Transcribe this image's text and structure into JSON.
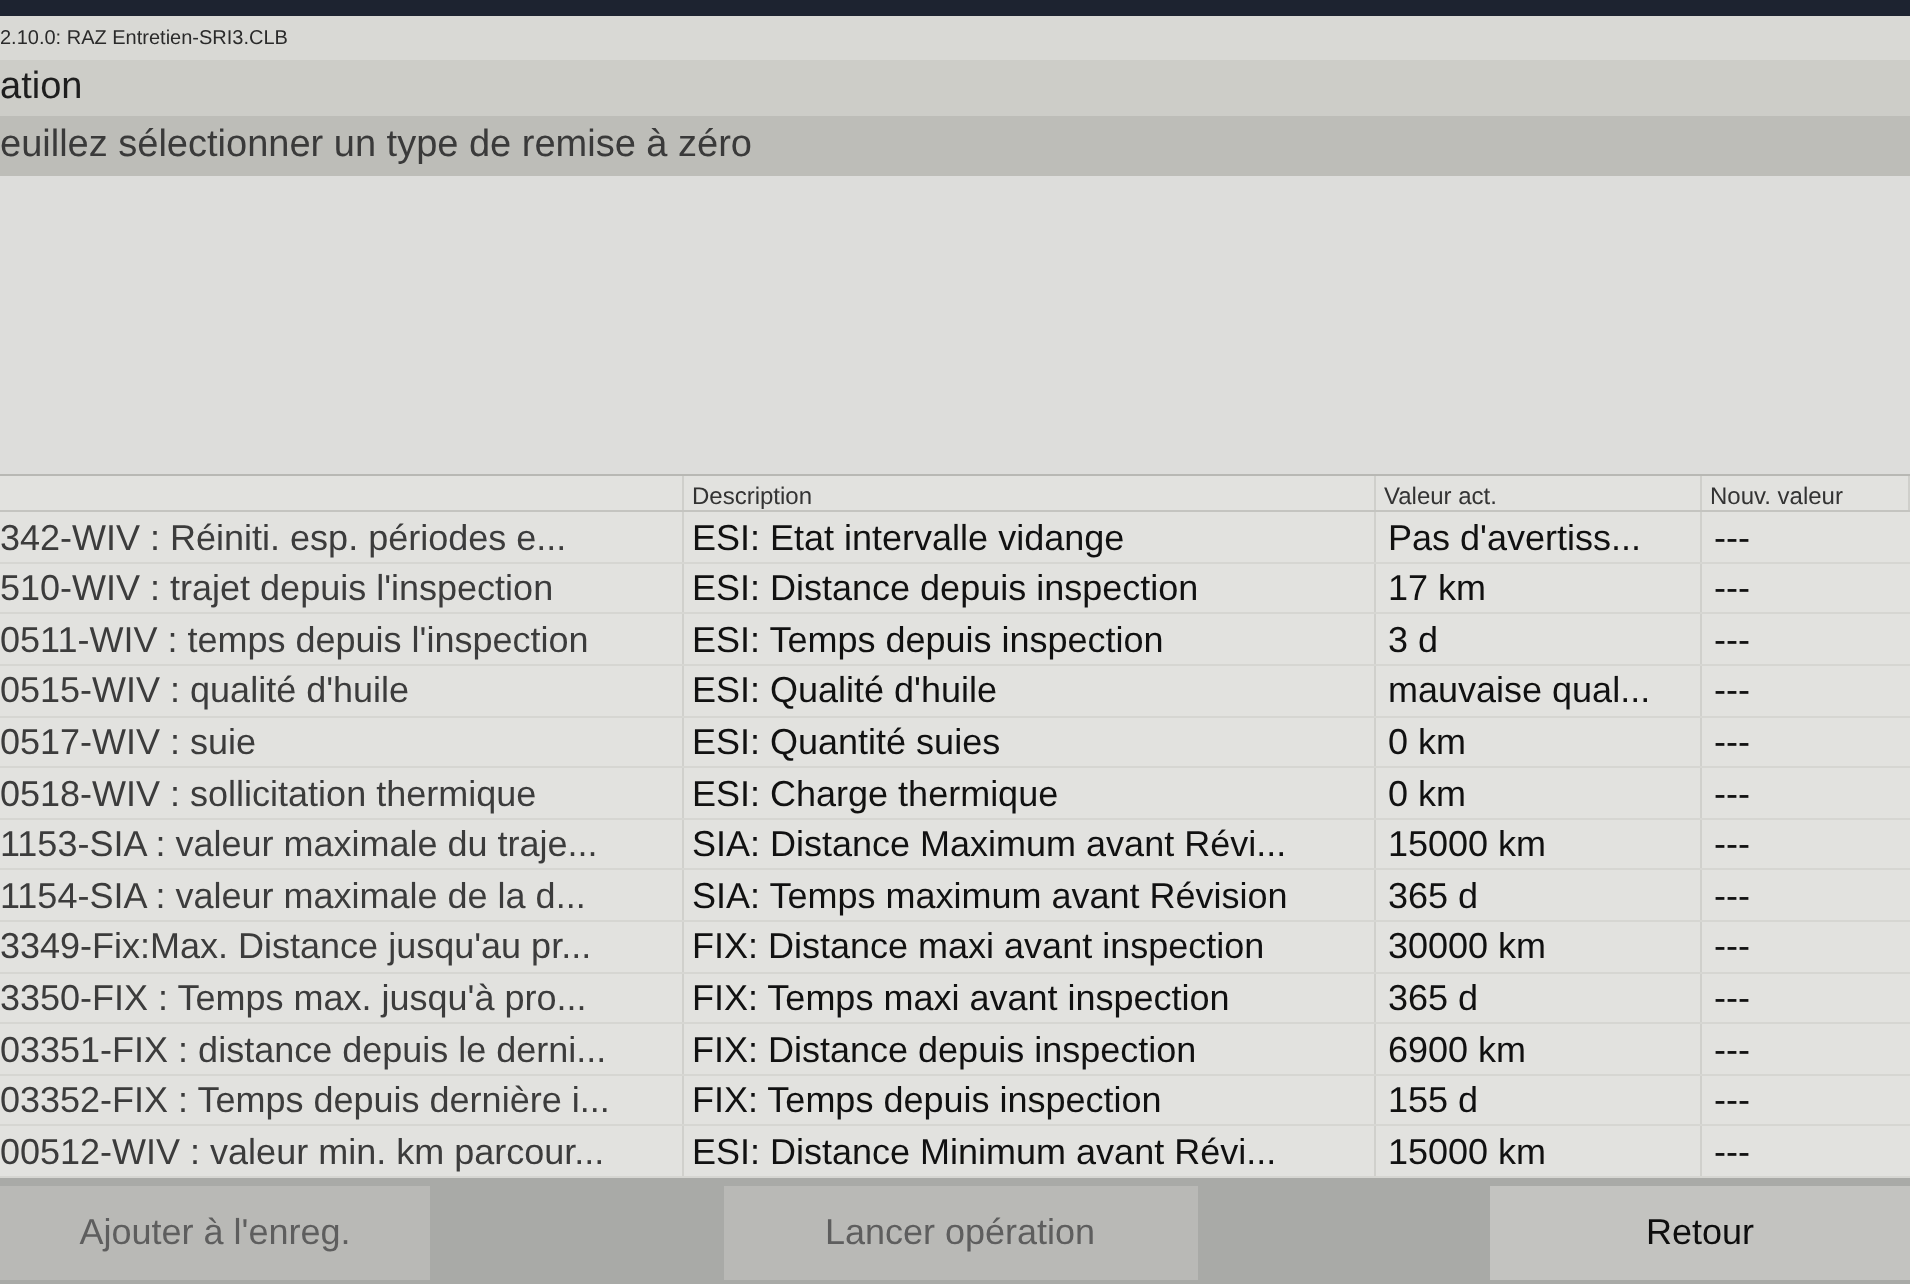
{
  "window": {
    "title": "2.10.0: RAZ Entretien-SRI3.CLB"
  },
  "header": {
    "title": "ation"
  },
  "prompt": "euillez sélectionner un type de remise à zéro",
  "table": {
    "column_headers": [
      "Description",
      "Valeur act.",
      "Nouv. valeur"
    ],
    "rows": [
      {
        "column_1": "342-WIV : Réiniti. esp. périodes e...",
        "description": "ESI: Etat intervalle vidange",
        "valeur_act": "Pas d'avertiss...",
        "nouv_valeur": "---"
      },
      {
        "column_1": "510-WIV : trajet depuis l'inspection",
        "description": "ESI: Distance depuis inspection",
        "valeur_act": "17 km",
        "nouv_valeur": "---"
      },
      {
        "column_1": "0511-WIV : temps depuis l'inspection",
        "description": "ESI: Temps depuis inspection",
        "valeur_act": "3 d",
        "nouv_valeur": "---"
      },
      {
        "column_1": "0515-WIV : qualité d'huile",
        "description": "ESI: Qualité d'huile",
        "valeur_act": "mauvaise qual...",
        "nouv_valeur": "---"
      },
      {
        "column_1": "0517-WIV : suie",
        "description": "ESI: Quantité suies",
        "valeur_act": "0 km",
        "nouv_valeur": "---"
      },
      {
        "column_1": "0518-WIV : sollicitation thermique",
        "description": "ESI: Charge thermique",
        "valeur_act": "0 km",
        "nouv_valeur": "---"
      },
      {
        "column_1": "1153-SIA : valeur maximale du traje...",
        "description": "SIA: Distance Maximum avant Révi...",
        "valeur_act": "15000 km",
        "nouv_valeur": "---"
      },
      {
        "column_1": "1154-SIA : valeur maximale de la d...",
        "description": "SIA: Temps maximum avant Révision",
        "valeur_act": "365 d",
        "nouv_valeur": "---"
      },
      {
        "column_1": "3349-Fix:Max. Distance jusqu'au pr...",
        "description": "FIX: Distance maxi avant inspection",
        "valeur_act": "30000 km",
        "nouv_valeur": "---"
      },
      {
        "column_1": "3350-FIX : Temps max. jusqu'à pro...",
        "description": "FIX: Temps maxi avant inspection",
        "valeur_act": "365 d",
        "nouv_valeur": "---"
      },
      {
        "column_1": "03351-FIX : distance depuis le derni...",
        "description": "FIX: Distance depuis inspection",
        "valeur_act": "6900 km",
        "nouv_valeur": "---"
      },
      {
        "column_1": "03352-FIX : Temps depuis dernière i...",
        "description": "FIX: Temps depuis inspection",
        "valeur_act": "155 d",
        "nouv_valeur": "---"
      },
      {
        "column_1": "00512-WIV : valeur min. km parcour...",
        "description": "ESI: Distance Minimum avant Révi...",
        "valeur_act": "15000 km",
        "nouv_valeur": "---"
      }
    ]
  },
  "buttons": [
    {
      "label": "Ajouter à l'enreg.",
      "disabled": true
    },
    {
      "label": "Lancer opération",
      "disabled": true
    },
    {
      "label": "Retour",
      "disabled": false
    }
  ]
}
